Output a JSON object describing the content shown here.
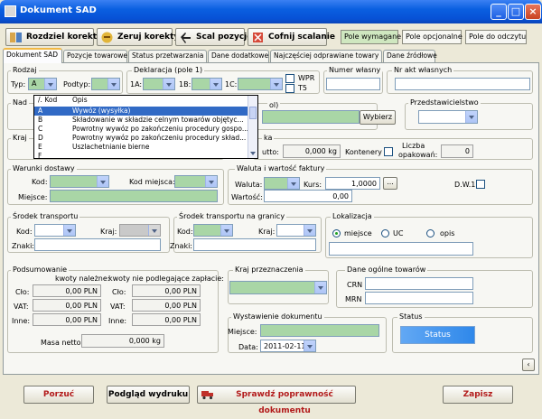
{
  "window": {
    "title": "Dokument SAD"
  },
  "toolbar": {
    "split": "Rozdziel korektę",
    "reset": "Zeruj korekty",
    "merge": "Scal pozycje",
    "undo": "Cofnij scalanie",
    "required": "Pole wymagane",
    "optional": "Pole opcjonalne",
    "readonly": "Pole do odczytu"
  },
  "tabs": [
    "Dokument SAD",
    "Pozycje towarowe",
    "Status przetwarzania",
    "Dane dodatkowe",
    "Najczęściej odprawiane towary",
    "Dane źródłowe"
  ],
  "rodzaj": {
    "title": "Rodzaj",
    "typ_label": "Typ:",
    "typ_value": "A",
    "podtyp_label": "Podtyp:"
  },
  "deklaracja": {
    "title": "Deklaracja (pole 1)",
    "l1": "1A:",
    "l2": "1B:",
    "l3": "1C:",
    "wpr": "WPR",
    "t5": "T5"
  },
  "numer_wlasny": {
    "title": "Numer własny"
  },
  "nr_akt": {
    "title": "Nr akt własnych"
  },
  "popup": {
    "head_key": "Kod",
    "head_desc": "Opis",
    "rows": [
      {
        "k": "A",
        "o": "Wywóz (wysyłka)"
      },
      {
        "k": "B",
        "o": "Składowanie w składzie celnym towarów objętyc..."
      },
      {
        "k": "C",
        "o": "Powrotny wywóz po zakończeniu procedury gospo..."
      },
      {
        "k": "D",
        "o": "Powrotny wywóz po zakończeniu procedury skład..."
      },
      {
        "k": "E",
        "o": "Uszlachetnianie bierne"
      },
      {
        "k": "F",
        "o": ""
      }
    ]
  },
  "nadawca": {
    "title": "Nad",
    "partial": "ol)",
    "choose": "Wybierz"
  },
  "przedstawiciel": {
    "title": "Przedstawicielstwo"
  },
  "kraj": {
    "title": "Kraj"
  },
  "masa": {
    "partial": "ka",
    "prefix": "utto:",
    "value": "0,000 kg",
    "kontenery": "Kontenery",
    "liczba": "Liczba",
    "opak": "opakowań:",
    "liczba_value": "0"
  },
  "warunki": {
    "title": "Warunki dostawy",
    "kod": "Kod:",
    "kod_miejsca": "Kod miejsca:",
    "miejsce": "Miejsce:"
  },
  "waluta": {
    "title": "Waluta i wartość faktury",
    "waluta": "Waluta:",
    "kurs": "Kurs:",
    "kurs_value": "1,0000",
    "wartosc": "Wartość:",
    "wartosc_value": "0,00",
    "dw1": "D.W.1"
  },
  "srodek": {
    "title": "Środek transportu",
    "kod": "Kod:",
    "kraj": "Kraj:",
    "znaki": "Znaki:"
  },
  "srodek_granica": {
    "title": "Środek transportu na granicy",
    "kod": "Kod:",
    "kraj": "Kraj:",
    "znaki": "Znaki:"
  },
  "lokalizacja": {
    "title": "Lokalizacja",
    "opt1": "miejsce",
    "opt2": "UC",
    "opt3": "opis"
  },
  "podsumowanie": {
    "title": "Podsumowanie",
    "col1": "kwoty należne:",
    "col2": "kwoty nie podlegające zapłacie:",
    "clo": "Cło:",
    "vat": "VAT:",
    "inne": "Inne:",
    "v": "0,00 PLN",
    "masa_netto": "Masa netto:",
    "masa_netto_value": "0,000 kg"
  },
  "kraj_przeznaczenia": {
    "title": "Kraj przeznaczenia"
  },
  "dane_ogolne": {
    "title": "Dane ogólne towarów",
    "crn": "CRN",
    "mrn": "MRN"
  },
  "wystawienie": {
    "title": "Wystawienie dokumentu",
    "miejsce": "Miejsce:",
    "data": "Data:",
    "data_value": "2011-02-11"
  },
  "status": {
    "title": "Status",
    "value": "Status"
  },
  "bottom": {
    "cancel": "Porzuć",
    "preview": "Podgląd wydruku",
    "check": "Sprawdź poprawność dokumentu",
    "save": "Zapisz"
  }
}
